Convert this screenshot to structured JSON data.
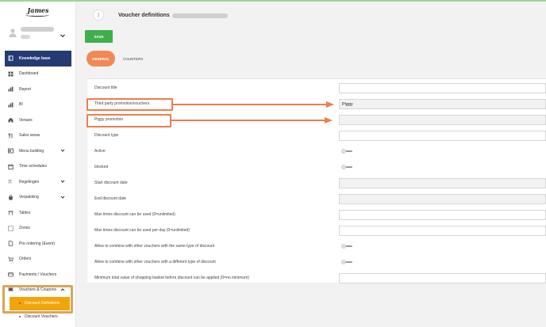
{
  "brand": {
    "logo_text": "James"
  },
  "sidebar": {
    "items": [
      {
        "label": "Knowledge base",
        "icon": "book-icon",
        "active": true
      },
      {
        "label": "Dashboard",
        "icon": "dashboard-icon"
      },
      {
        "label": "Report",
        "icon": "bar-chart-icon"
      },
      {
        "label": "BI",
        "icon": "bar-chart-icon"
      },
      {
        "label": "Venues",
        "icon": "home-icon"
      },
      {
        "label": "Sales areas",
        "icon": "cutlery-icon"
      },
      {
        "label": "Menu building",
        "icon": "menu-icon",
        "expandable": true
      },
      {
        "label": "Time schedules",
        "icon": "calendar-icon"
      },
      {
        "label": "Regelingen",
        "icon": "translate-icon",
        "expandable": true
      },
      {
        "label": "Verpakking",
        "icon": "bag-icon",
        "expandable": true
      },
      {
        "label": "Tables",
        "icon": "table-icon"
      },
      {
        "label": "Zones",
        "icon": "zones-icon"
      },
      {
        "label": "Pre ordering (Event)",
        "icon": "document-icon"
      },
      {
        "label": "Orders",
        "icon": "cart-icon"
      },
      {
        "label": "Payments / Vouchers",
        "icon": "wallet-icon"
      },
      {
        "label": "Vouchers & Coupons",
        "icon": "ticket-icon",
        "expanded": true
      }
    ],
    "subitems": [
      {
        "label": "Discount Definitions",
        "selected": true
      },
      {
        "label": "Discount Vouchers",
        "selected": false
      }
    ]
  },
  "header": {
    "title": "Voucher definitions"
  },
  "toolbar": {
    "save_label": "SAVE"
  },
  "tabs": [
    {
      "label": "GENERAL",
      "active": true
    },
    {
      "label": "COUNTERS",
      "active": false
    }
  ],
  "form": {
    "fields": [
      {
        "label": "Discount title",
        "type": "text",
        "value": ""
      },
      {
        "label": "Third party promotion/vouchers",
        "type": "select",
        "value": "Piggy"
      },
      {
        "label": "Piggy promotion",
        "type": "select",
        "value": ""
      },
      {
        "label": "Discount type",
        "type": "select",
        "value": ""
      },
      {
        "label": "Active",
        "type": "toggle",
        "value": false
      },
      {
        "label": "blocked",
        "type": "toggle",
        "value": false
      },
      {
        "label": "Start discount date",
        "type": "date",
        "value": ""
      },
      {
        "label": "End discount date",
        "type": "date",
        "value": ""
      },
      {
        "label": "Max times discount can be used (0=unlimited)",
        "type": "number",
        "value": ""
      },
      {
        "label": "Max times discount can be used per day (0=unlimited)",
        "type": "number",
        "value": ""
      },
      {
        "label": "Allow to combine with other vouchers with the same type of discount",
        "type": "toggle",
        "value": false
      },
      {
        "label": "Allow to combine with other vouchers with a different type of discount",
        "type": "toggle",
        "value": false
      },
      {
        "label": "Minimum total value of shopping basket before discount can be applied (0=no minimum)",
        "type": "number",
        "value": ""
      }
    ]
  },
  "colors": {
    "active_nav": "#233a73",
    "selected_sub": "#f0a50a",
    "save_button": "#3fae4b",
    "tab_active": "#ee8a55",
    "annotation": "#ee7d4d",
    "highlight": "#d9a65a"
  }
}
